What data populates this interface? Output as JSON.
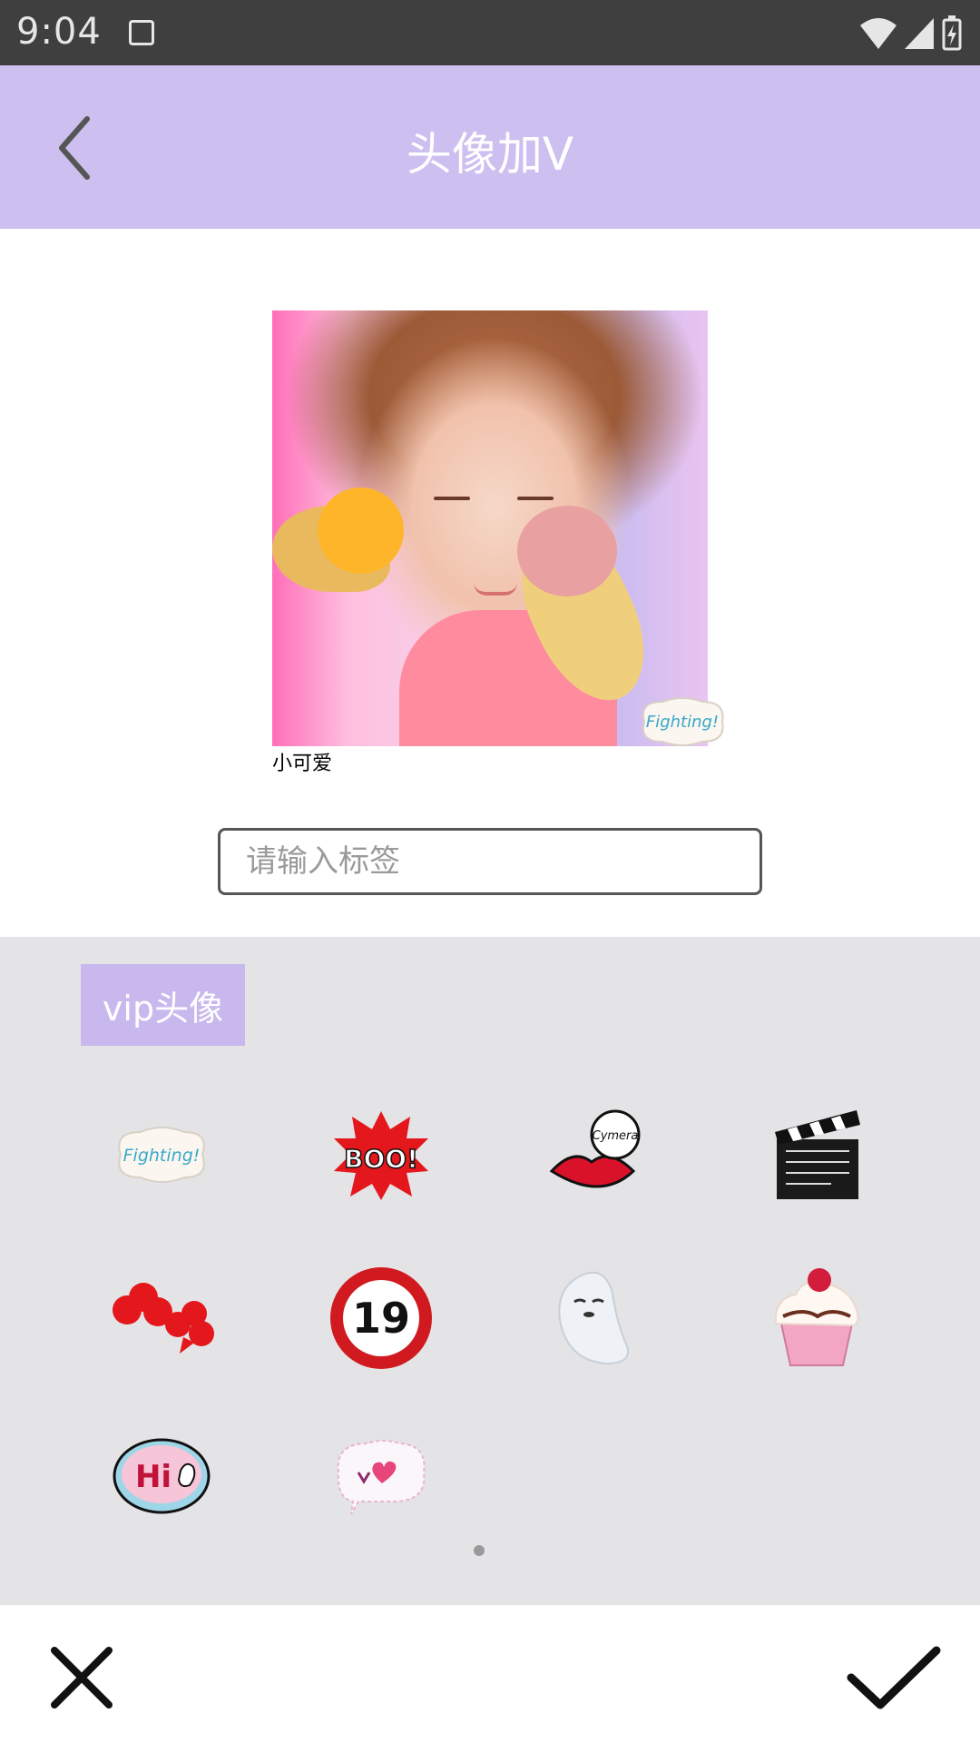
{
  "status_bar": {
    "time": "9:04",
    "icons": [
      "app-notification-icon",
      "wifi-icon",
      "cell-signal-icon",
      "battery-icon"
    ]
  },
  "app_bar": {
    "title": "头像加V",
    "back_icon": "chevron-left-icon"
  },
  "preview": {
    "caption": "小可爱",
    "overlay_sticker_text": "Fighting!"
  },
  "tag_input": {
    "value": "",
    "placeholder": "请输入标签"
  },
  "sticker_panel": {
    "category_label": "vip头像",
    "stickers": [
      {
        "name": "fighting-sticker",
        "text": "Fighting!"
      },
      {
        "name": "boo-sticker",
        "text": "BOO!"
      },
      {
        "name": "cymera-lips-sticker",
        "text": "Cymera"
      },
      {
        "name": "clapperboard-sticker",
        "text": ""
      },
      {
        "name": "clover-speech-sticker",
        "text": ""
      },
      {
        "name": "age-19-sticker",
        "text": "19"
      },
      {
        "name": "ghost-sticker",
        "text": ""
      },
      {
        "name": "cupcake-sticker",
        "text": ""
      },
      {
        "name": "hi-sticker",
        "text": "Hi"
      },
      {
        "name": "heart-bubble-sticker",
        "text": ""
      }
    ],
    "page_indicator": {
      "current": 1,
      "total": 1
    }
  },
  "bottom_bar": {
    "cancel_icon": "close-icon",
    "confirm_icon": "checkmark-icon"
  },
  "colors": {
    "app_bar": "#cdbff0",
    "category_tab": "#c8b8ee",
    "panel_bg": "#e4e3e5",
    "status_bar": "#3f3f3f"
  }
}
